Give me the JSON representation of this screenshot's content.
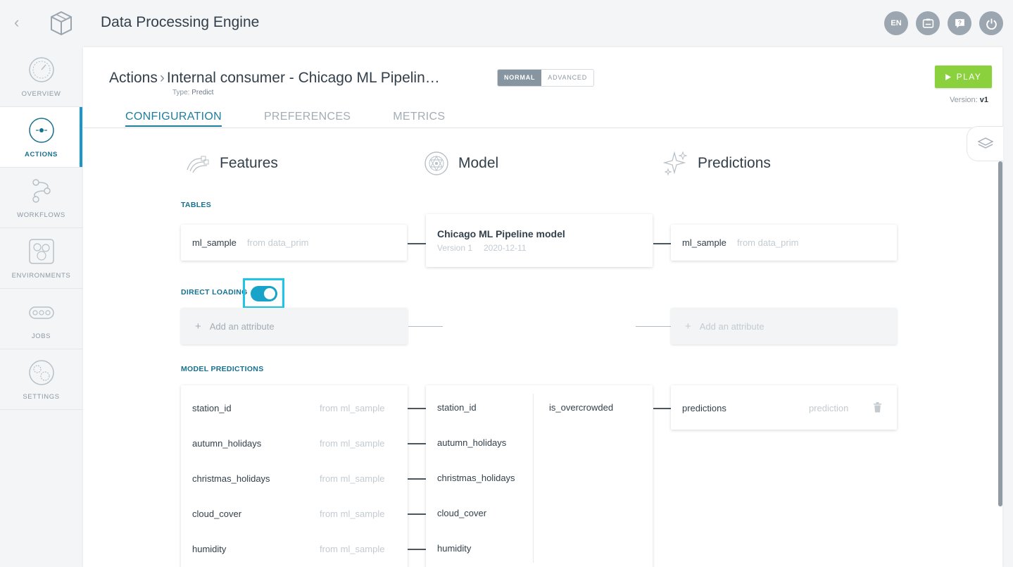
{
  "app": {
    "title": "Data Processing Engine"
  },
  "topbar": {
    "lang": "EN"
  },
  "sidebar": {
    "items": [
      {
        "label": "OVERVIEW"
      },
      {
        "label": "ACTIONS"
      },
      {
        "label": "WORKFLOWS"
      },
      {
        "label": "ENVIRONMENTS"
      },
      {
        "label": "JOBS"
      },
      {
        "label": "SETTINGS"
      }
    ]
  },
  "header": {
    "root": "Actions",
    "title": "Internal consumer - Chicago ML Pipelin…",
    "type_label": "Type:",
    "type_value": "Predict",
    "mode_normal": "NORMAL",
    "mode_advanced": "ADVANCED",
    "play": "PLAY",
    "version_label": "Version:",
    "version_value": "v1"
  },
  "tabs": [
    {
      "label": "CONFIGURATION",
      "active": true
    },
    {
      "label": "PREFERENCES"
    },
    {
      "label": "METRICS"
    }
  ],
  "columns": {
    "features": "Features",
    "model": "Model",
    "predictions": "Predictions"
  },
  "sections": {
    "tables": "TABLES",
    "direct_loading": "DIRECT LOADING",
    "model_predictions": "MODEL PREDICTIONS"
  },
  "tables": {
    "feature_table": {
      "name": "ml_sample",
      "source": "from data_prim"
    },
    "model": {
      "name": "Chicago ML Pipeline model",
      "version": "Version 1",
      "date": "2020-12-11"
    },
    "prediction_table": {
      "name": "ml_sample",
      "source": "from data_prim"
    }
  },
  "direct_loading": {
    "enabled": true,
    "add_attribute": "Add an attribute"
  },
  "features": [
    {
      "name": "station_id",
      "source": "from ml_sample"
    },
    {
      "name": "autumn_holidays",
      "source": "from ml_sample"
    },
    {
      "name": "christmas_holidays",
      "source": "from ml_sample"
    },
    {
      "name": "cloud_cover",
      "source": "from ml_sample"
    },
    {
      "name": "humidity",
      "source": "from ml_sample"
    }
  ],
  "model_inputs": [
    "station_id",
    "autumn_holidays",
    "christmas_holidays",
    "cloud_cover",
    "humidity"
  ],
  "model_output": "is_overcrowded",
  "prediction": {
    "name": "predictions",
    "type": "prediction"
  }
}
